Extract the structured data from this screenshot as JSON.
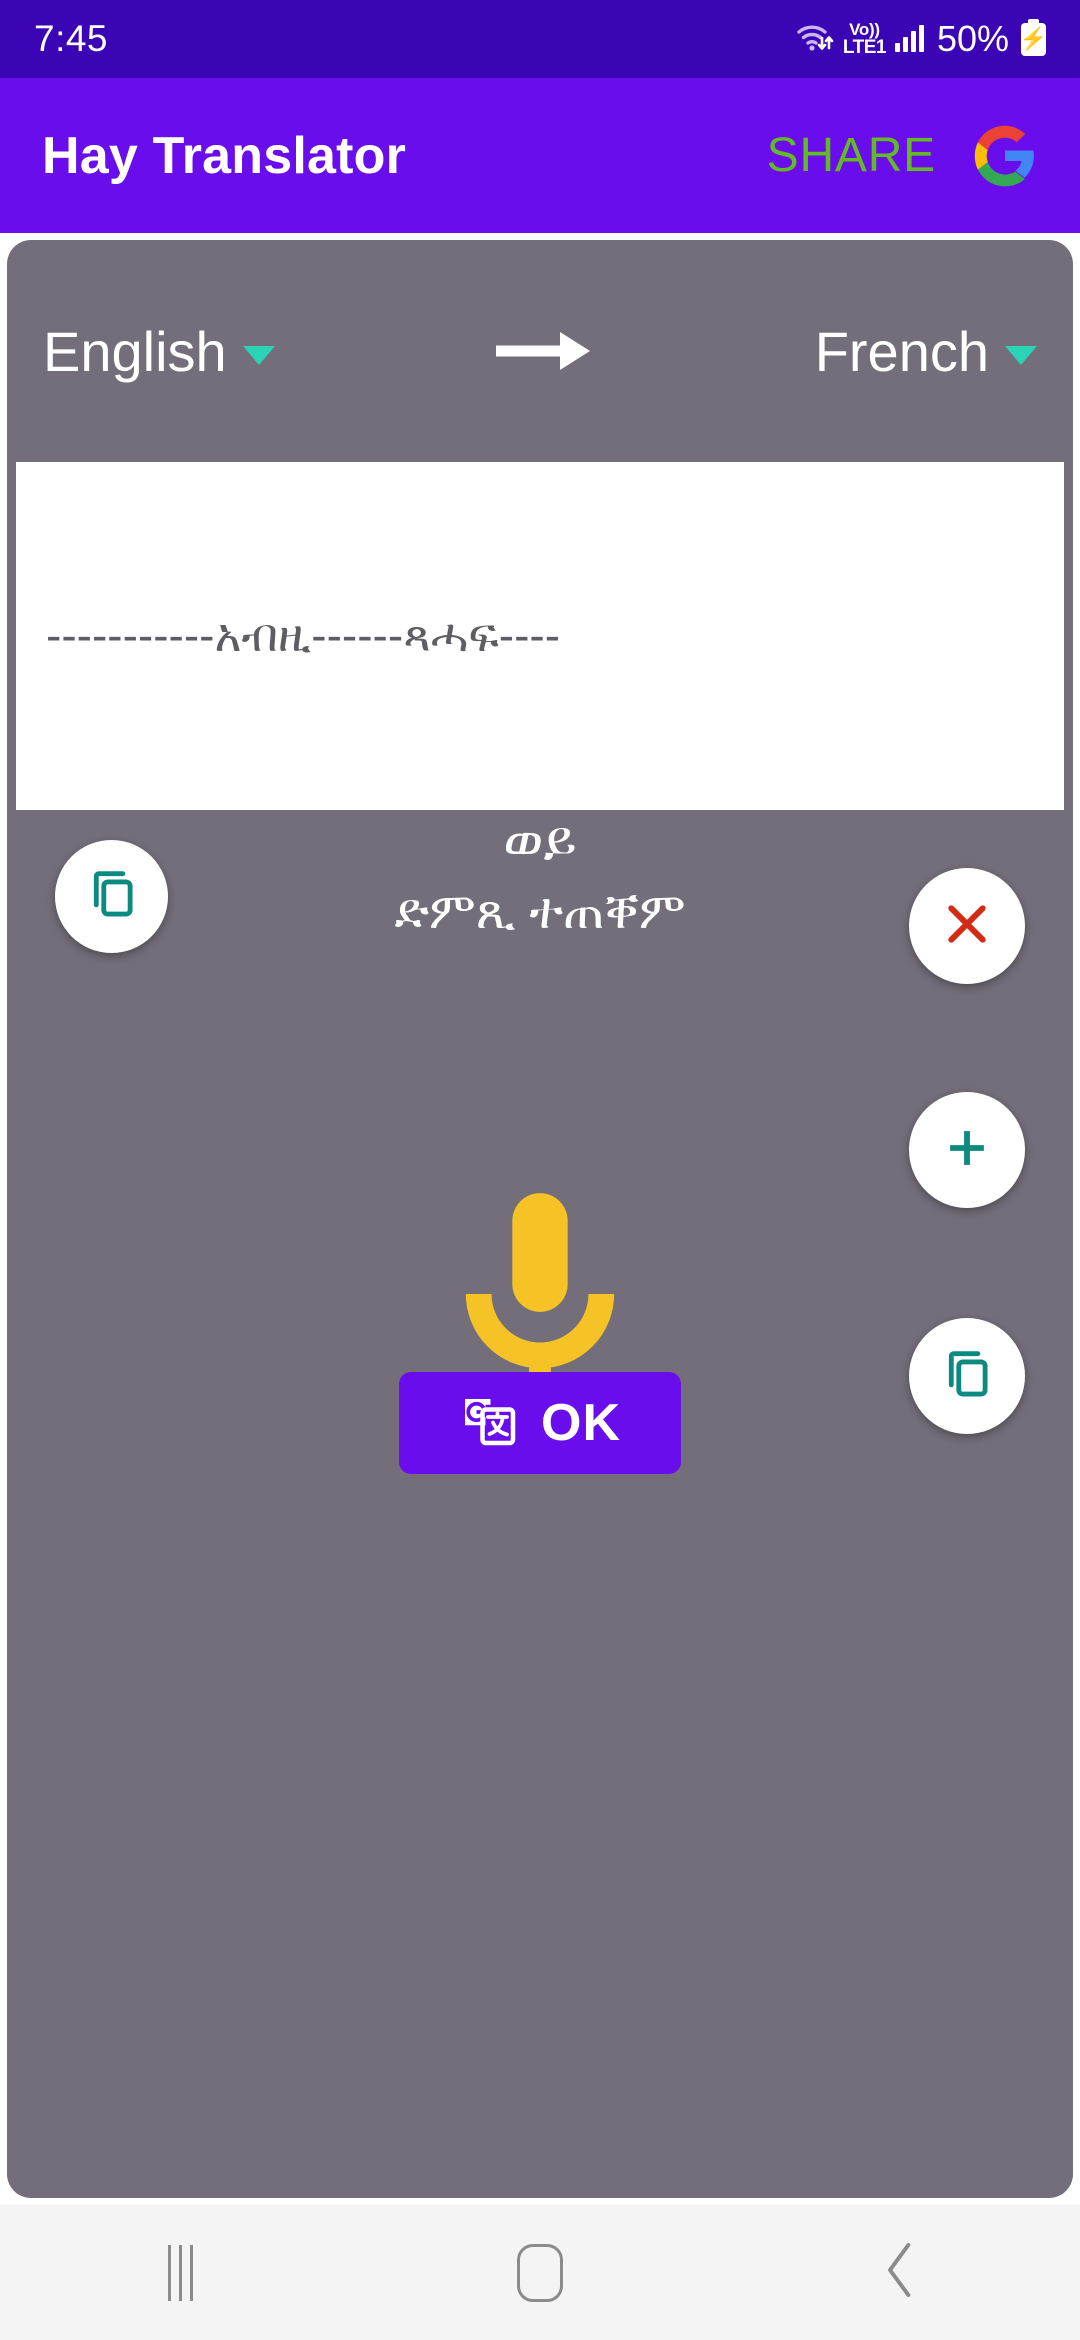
{
  "status_bar": {
    "time": "7:45",
    "wifi_icon": "wifi-arrows-icon",
    "volte_top": "Vo))",
    "volte_bottom": "LTE1",
    "signal_icon": "signal-bars-icon",
    "battery_percent": "50%",
    "battery_icon": "battery-charging-icon",
    "background": "#3b05b6"
  },
  "app_bar": {
    "title": "Hay Translator",
    "share_label": "SHARE",
    "share_color": "#63bb24",
    "logo_icon": "google-g-logo",
    "background": "#6a0ded"
  },
  "card": {
    "background": "#736e79"
  },
  "language_row": {
    "source_language": "English",
    "source_caret_icon": "chevron-down-icon",
    "swap_icon": "arrow-right-icon",
    "target_language": "French",
    "target_caret_icon": "chevron-down-icon",
    "caret_color": "#2ad4b4"
  },
  "input_field": {
    "value": "-----------አብዚ------ጻሓፍ----",
    "placeholder": "-----------አብዚ------ጻሓፍ----",
    "background": "#ffffff",
    "text_color": "#5d5d63"
  },
  "prompt": {
    "line1": "ወይ",
    "line2": "ድምጺ ተጠቐም"
  },
  "actions": {
    "copy_left_icon": "copy-icon",
    "clear_icon": "close-x-icon",
    "add_icon": "plus-icon",
    "copy_right_icon": "copy-icon",
    "mic_icon": "microphone-icon",
    "icon_teal": "#0d8a80",
    "clear_red": "#d32b16",
    "mic_yellow": "#f6c326"
  },
  "ok_button": {
    "label": "OK",
    "icon": "google-translate-icon",
    "background": "#6a0ded"
  },
  "nav_bar": {
    "recents_icon": "recents-icon",
    "home_icon": "home-icon",
    "back_icon": "back-chevron-icon",
    "background": "#f4f4f5"
  }
}
